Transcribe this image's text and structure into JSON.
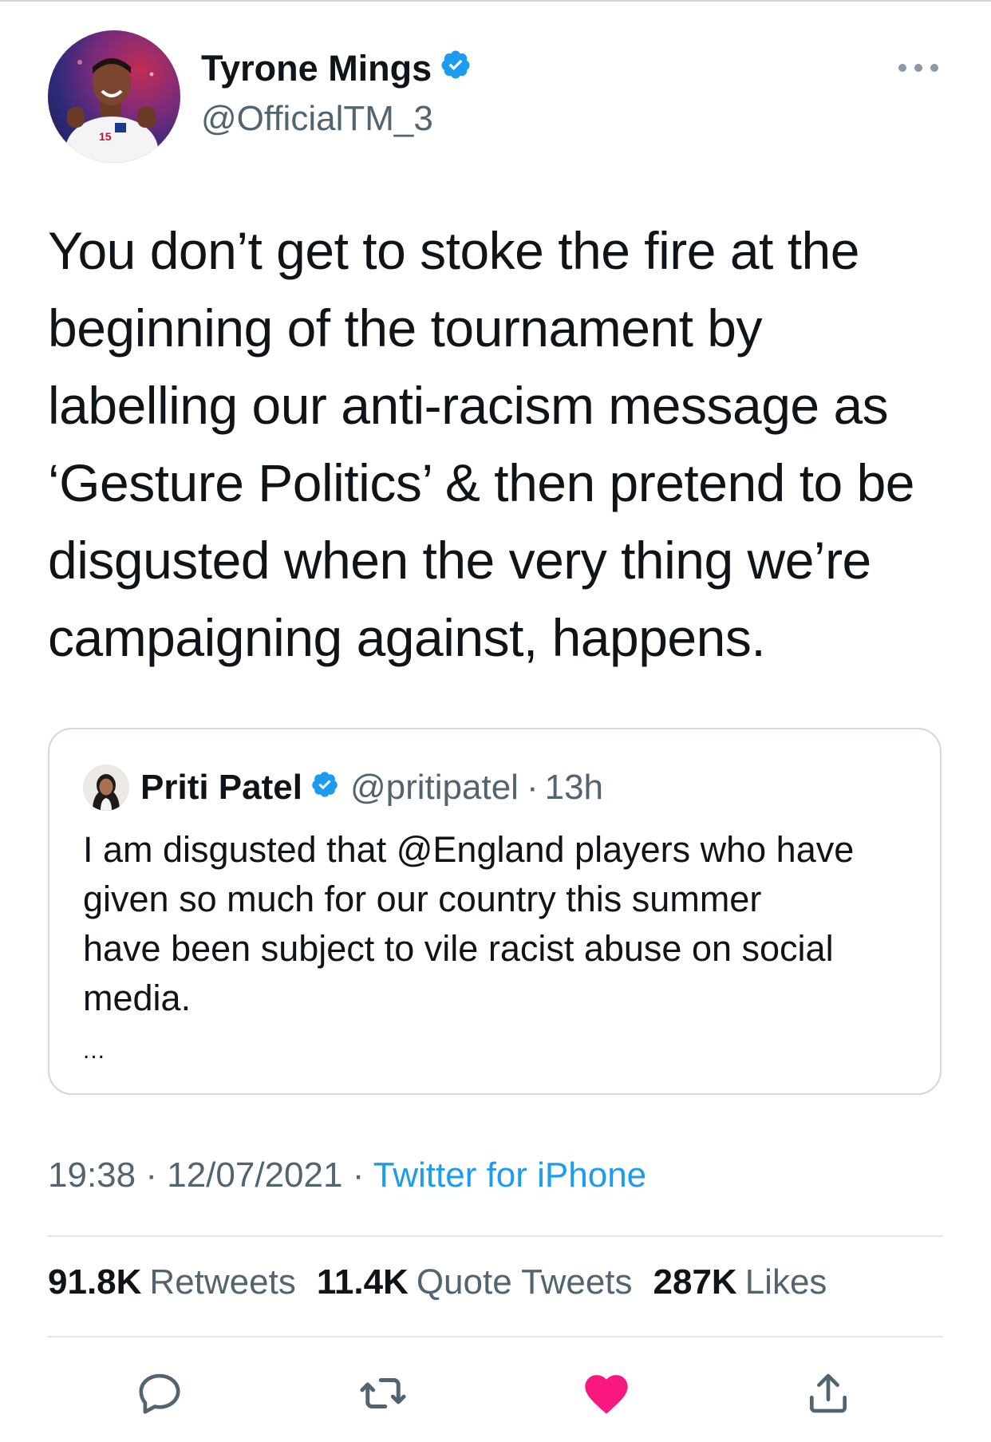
{
  "tweet": {
    "author": {
      "name": "Tyrone Mings",
      "handle": "@OfficialTM_3",
      "avatar_icon": "profile-photo-england-player"
    },
    "text_lines": [
      "You don’t get to stoke the fire at the",
      "beginning of the tournament by",
      "labelling our anti-racism message as",
      "‘Gesture Politics’ & then pretend to be",
      "disgusted when the very thing we’re",
      "campaigning against, happens."
    ],
    "quoted": {
      "name": "Priti Patel",
      "handle": "@pritipatel",
      "age": "13h",
      "separator": "·",
      "text_lines": [
        "I am disgusted that @England players who have",
        "given so much for our country this summer",
        "have been subject to vile racist abuse on social",
        "media."
      ],
      "ellipsis": "..."
    },
    "time": "19:38",
    "date": "12/07/2021",
    "separator": "·",
    "source": "Twitter for iPhone",
    "stats": {
      "retweets_count": "91.8K",
      "retweets_label": "Retweets",
      "quotes_count": "11.4K",
      "quotes_label": "Quote Tweets",
      "likes_count": "287K",
      "likes_label": "Likes"
    },
    "liked": true
  },
  "colors": {
    "verified": "#1d9bf0",
    "link": "#1d9bf0",
    "like_active": "#f91880",
    "secondary_text": "#536471"
  }
}
